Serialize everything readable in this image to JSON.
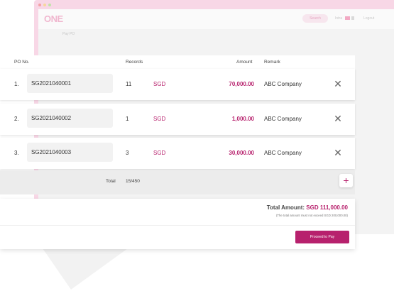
{
  "background_app": {
    "logo": "ONE",
    "search_placeholder": "Search",
    "menu_item_1": "Intra",
    "menu_item_2": "Logout",
    "breadcrumb": "Pay PO",
    "colors": {
      "frame": "#f8d7e6",
      "accent": "#b7216d"
    }
  },
  "table": {
    "headers": {
      "po_no": "PO No.",
      "records": "Records",
      "amount": "Amount",
      "remark": "Remark"
    },
    "rows": [
      {
        "index": "1.",
        "po_number": "SG2021040001",
        "records": "11",
        "currency": "SGD",
        "amount": "70,000.00",
        "remark": "ABC Company"
      },
      {
        "index": "2.",
        "po_number": "SG2021040002",
        "records": "1",
        "currency": "SGD",
        "amount": "1,000.00",
        "remark": "ABC Company"
      },
      {
        "index": "3.",
        "po_number": "SG2021040003",
        "records": "3",
        "currency": "SGD",
        "amount": "30,000.00",
        "remark": "ABC Company"
      }
    ],
    "total_label": "Total",
    "total_value": "15/450",
    "add_icon": "plus-icon",
    "remove_icon": "close-icon"
  },
  "summary": {
    "total_amount_label": "Total Amount:",
    "total_amount_value": "SGD 111,000.00",
    "note": "(The total amount must not exceed SGD 200,000.00)",
    "proceed_button": "Proceed to Pay"
  }
}
